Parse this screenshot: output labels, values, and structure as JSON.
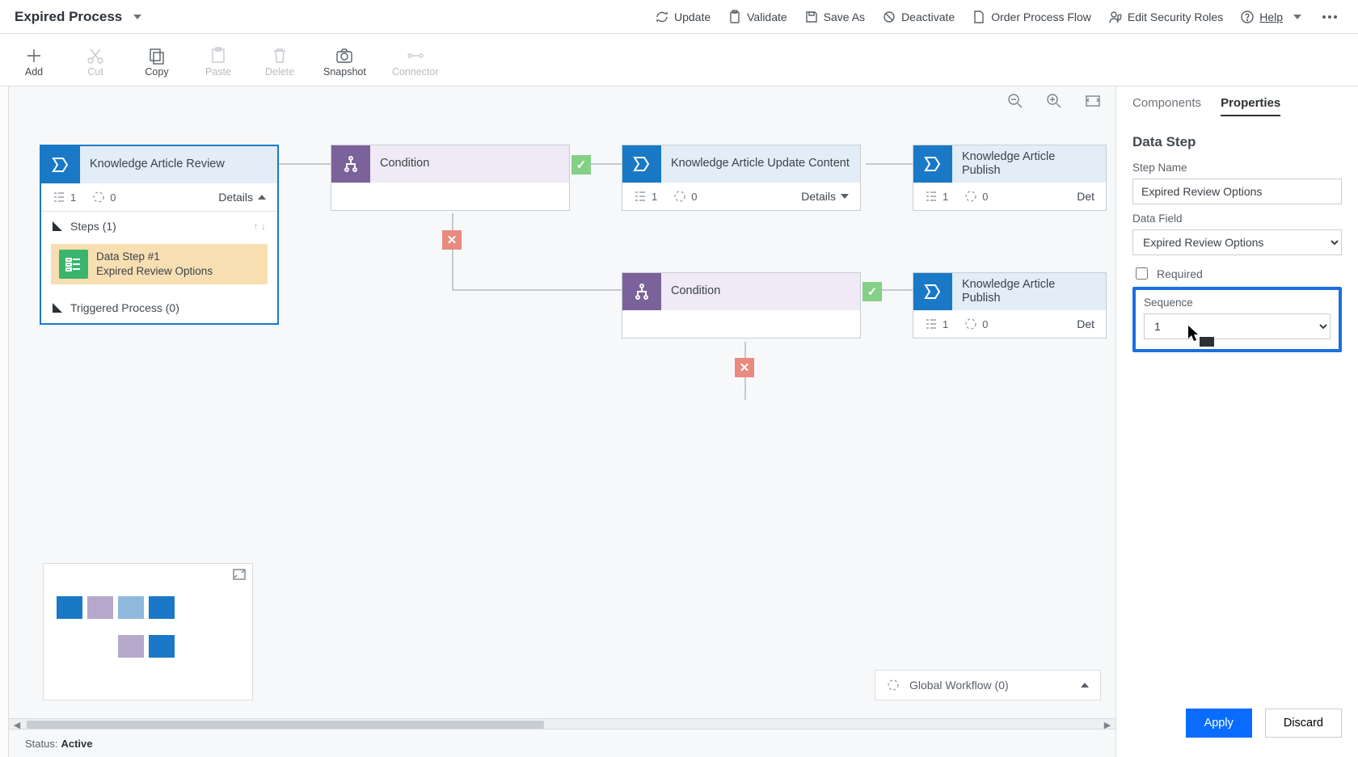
{
  "header": {
    "title": "Expired Process",
    "actions": {
      "update": "Update",
      "validate": "Validate",
      "save_as": "Save As",
      "deactivate": "Deactivate",
      "order": "Order Process Flow",
      "security": "Edit Security Roles",
      "help": "Help"
    }
  },
  "ribbon": {
    "add": "Add",
    "cut": "Cut",
    "copy": "Copy",
    "paste": "Paste",
    "delete": "Delete",
    "snapshot": "Snapshot",
    "connector": "Connector"
  },
  "nodes": {
    "review": {
      "title": "Knowledge Article Review",
      "steps": "1",
      "workflows": "0",
      "details": "Details",
      "exp_steps": "Steps (1)",
      "datastep_title": "Data Step #1",
      "datastep_value": "Expired Review Options",
      "triggered": "Triggered Process (0)"
    },
    "cond1": {
      "title": "Condition"
    },
    "update": {
      "title": "Knowledge Article Update Content",
      "steps": "1",
      "workflows": "0",
      "details": "Details"
    },
    "publish1": {
      "title": "Knowledge Article Publish",
      "steps": "1",
      "workflows": "0",
      "details": "Det"
    },
    "cond2": {
      "title": "Condition"
    },
    "publish2": {
      "title": "Knowledge Article Publish",
      "steps": "1",
      "workflows": "0",
      "details": "Det"
    }
  },
  "canvas": {
    "global_workflow": "Global Workflow (0)"
  },
  "status": {
    "label": "Status:",
    "value": "Active"
  },
  "panel": {
    "tabs": {
      "components": "Components",
      "properties": "Properties"
    },
    "section": "Data Step",
    "fields": {
      "step_name_label": "Step Name",
      "step_name_value": "Expired Review Options",
      "data_field_label": "Data Field",
      "data_field_value": "Expired Review Options",
      "required_label": "Required",
      "sequence_label": "Sequence",
      "sequence_value": "1"
    },
    "buttons": {
      "apply": "Apply",
      "discard": "Discard"
    }
  }
}
